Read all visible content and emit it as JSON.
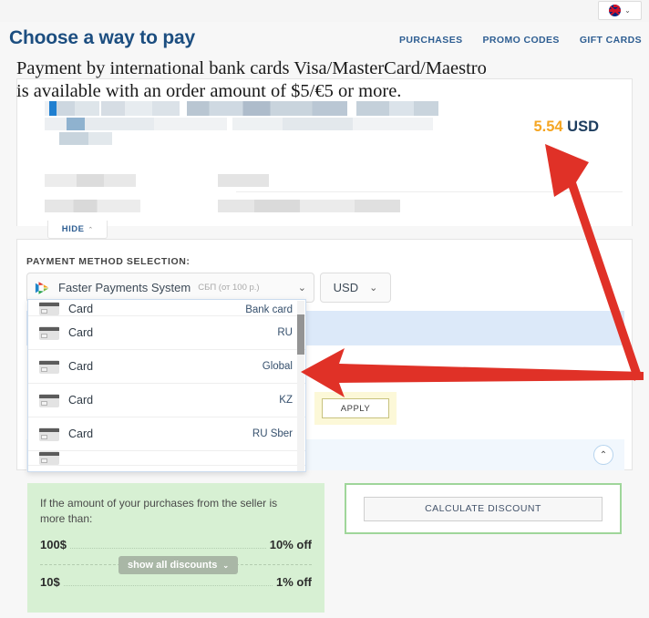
{
  "topbar": {
    "language": {
      "icon": "uk-flag-icon",
      "caret": "⌄"
    }
  },
  "header": {
    "title": "Choose a way to pay",
    "nav": [
      {
        "label": "PURCHASES"
      },
      {
        "label": "PROMO CODES"
      },
      {
        "label": "GIFT CARDS"
      }
    ]
  },
  "notice": {
    "line1": "Payment by international bank cards Visa/MasterCard/Maestro",
    "line2": "is available with an order amount of $5/€5 or more."
  },
  "order": {
    "hide_label": "HIDE",
    "hide_chevron": "⌃",
    "price_amount": "5.54",
    "price_currency": "USD"
  },
  "payment": {
    "section_label": "PAYMENT METHOD SELECTION:",
    "method": {
      "icon": "sbp-logo-icon",
      "name": "Faster Payments System",
      "sub": "СБП (от 100 р.)",
      "caret": "⌄"
    },
    "currency": {
      "value": "USD",
      "caret": "⌄"
    },
    "apply_label": "APPLY",
    "collapse_chevron": "⌃",
    "dropdown": {
      "options": [
        {
          "icon": "card-icon",
          "name": "Card",
          "tag": "Bank card",
          "clipped": "top"
        },
        {
          "icon": "card-icon",
          "name": "Card",
          "tag": "RU",
          "clipped": ""
        },
        {
          "icon": "card-icon",
          "name": "Card",
          "tag": "Global",
          "clipped": ""
        },
        {
          "icon": "card-icon",
          "name": "Card",
          "tag": "KZ",
          "clipped": ""
        },
        {
          "icon": "card-icon",
          "name": "Card",
          "tag": "RU Sber",
          "clipped": ""
        },
        {
          "icon": "card-icon",
          "name": "",
          "tag": "",
          "clipped": "bottom"
        }
      ]
    }
  },
  "discounts": {
    "title": "If the amount of your purchases from the seller is more than:",
    "rows": [
      {
        "threshold": "100$",
        "value": "10% off"
      },
      {
        "threshold": "10$",
        "value": "1% off"
      }
    ],
    "show_all_label": "show all discounts",
    "show_all_chevron": "⌄",
    "calculate_label": "CALCULATE DISCOUNT"
  },
  "colors": {
    "accent_blue": "#2e5e92",
    "price_orange": "#f5a623",
    "green_panel": "#d7f0d3",
    "annotation_red": "#e03127"
  }
}
